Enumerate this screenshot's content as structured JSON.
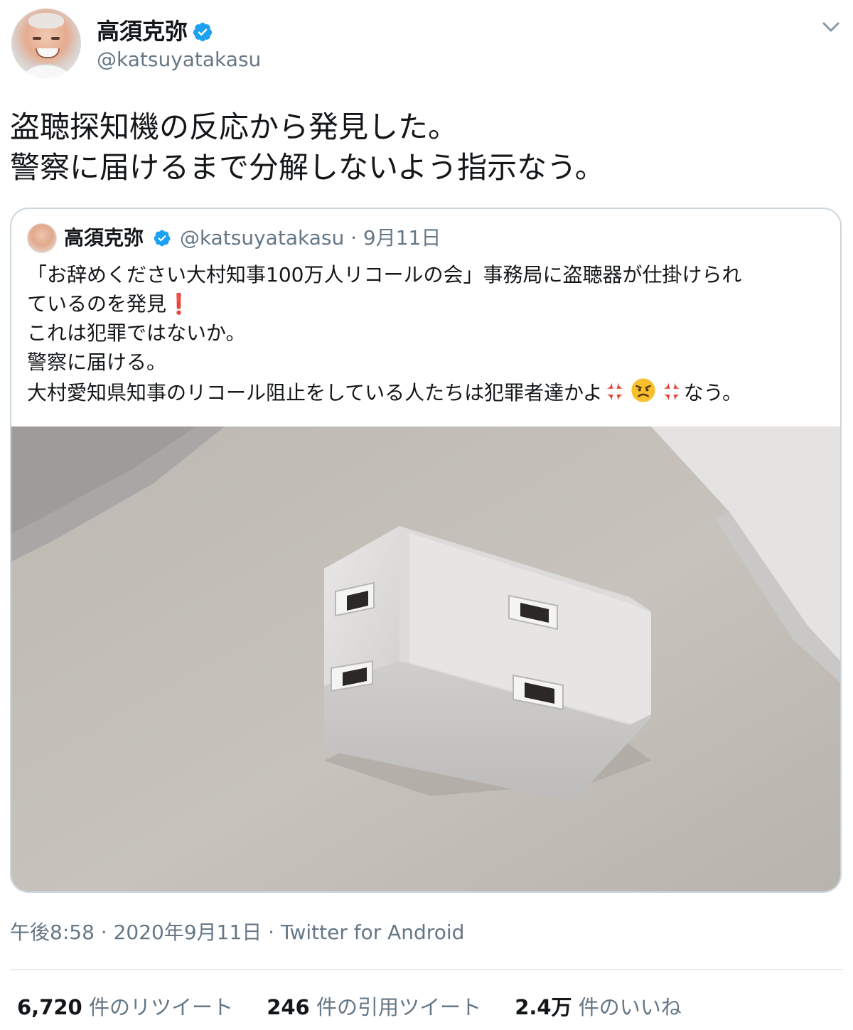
{
  "author": {
    "display_name": "高須克弥",
    "handle": "@katsuyatakasu",
    "verified": true,
    "avatar_icon": "profile-photo"
  },
  "tweet": {
    "text_lines": [
      "盗聴探知機の反応から発見した。",
      "警察に届けるまで分解しないよう指示なう。"
    ],
    "timestamp": "午後8:58 · 2020年9月11日 · Twitter for Android"
  },
  "quoted_tweet": {
    "display_name": "高須克弥",
    "handle": "@katsuyatakasu",
    "separator": "·",
    "date": "9月11日",
    "lines": {
      "l1": "「お辞めください大村知事100万人リコールの会」事務局に盗聴器が仕掛けられ",
      "l2a": "ているのを発見",
      "l2_emoji": "❗",
      "l3": "これは犯罪ではないか。",
      "l4": "警察に届ける。",
      "l5a": "大村愛知県知事のリコール阻止をしている人たちは犯罪者達かよ",
      "l5_emojis": [
        "anger-symbol",
        "angry-face",
        "anger-symbol"
      ],
      "l5b": "なう。"
    },
    "media": "photo of white power outlet adapter on desk"
  },
  "stats": {
    "retweets": {
      "count": "6,720",
      "label": "件のリツイート"
    },
    "quotes": {
      "count": "246",
      "label": "件の引用ツイート"
    },
    "likes": {
      "count": "2.4万",
      "label": "件のいいね"
    }
  },
  "colors": {
    "verified_blue": "#1da1f2",
    "secondary_text": "#657786",
    "border": "#ccd6dd"
  }
}
